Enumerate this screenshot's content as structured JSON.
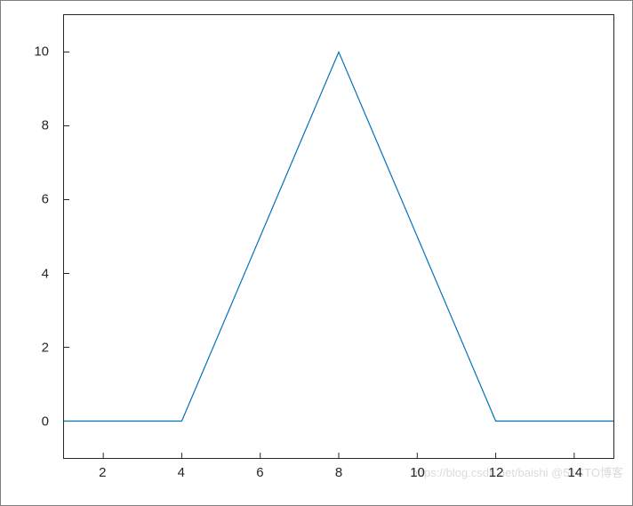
{
  "chart_data": {
    "type": "line",
    "x": [
      1,
      2,
      3,
      4,
      5,
      6,
      7,
      8,
      9,
      10,
      11,
      12,
      13,
      14,
      15
    ],
    "y": [
      0,
      0,
      0,
      0,
      2.5,
      5,
      7.5,
      10,
      7.5,
      5,
      2.5,
      0,
      0,
      0,
      0
    ],
    "xlabel": "",
    "ylabel": "",
    "title": "",
    "xlim": [
      1,
      15
    ],
    "ylim": [
      -1,
      11
    ],
    "xticks": [
      2,
      4,
      6,
      8,
      10,
      12,
      14
    ],
    "yticks": [
      0,
      2,
      4,
      6,
      8,
      10
    ],
    "line_color": "#0072BD"
  },
  "xtick_labels": [
    "2",
    "4",
    "6",
    "8",
    "10",
    "12",
    "14"
  ],
  "ytick_labels": [
    "0",
    "2",
    "4",
    "6",
    "8",
    "10"
  ],
  "watermark": "https://blog.csdn.net/baishi @51CTO博客"
}
